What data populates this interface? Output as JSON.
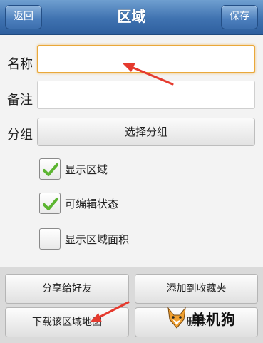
{
  "header": {
    "back_label": "返回",
    "title": "区域",
    "save_label": "保存"
  },
  "form": {
    "name_label": "名称",
    "name_value": "",
    "note_label": "备注",
    "note_value": "",
    "group_label": "分组",
    "group_button": "选择分组",
    "focus_color": "#e9a83a"
  },
  "options": [
    {
      "label": "显示区域",
      "checked": true
    },
    {
      "label": "可编辑状态",
      "checked": true
    },
    {
      "label": "显示区域面积",
      "checked": false
    }
  ],
  "actions": {
    "share": "分享给好友",
    "favorite": "添加到收藏夹",
    "download": "下载该区域地图",
    "delete": "删除"
  },
  "watermark": "单机狗",
  "colors": {
    "header": "#3f72b0",
    "check": "#5cb531",
    "arrow": "#e53a2e"
  }
}
